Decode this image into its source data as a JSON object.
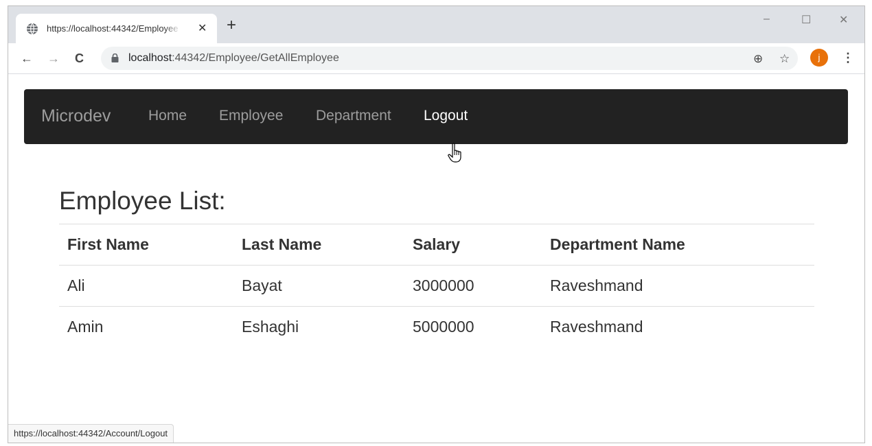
{
  "browser": {
    "tab_title": "https://localhost:44342/Employee",
    "tab_close": "✕",
    "new_tab": "+",
    "window_controls": {
      "minimize": "–",
      "maximize": "☐",
      "close": "✕"
    },
    "nav": {
      "back": "←",
      "forward": "→",
      "reload": "C"
    },
    "url": {
      "host": "localhost",
      "rest": ":44342/Employee/GetAllEmployee"
    },
    "icons": {
      "zoom": "⊕",
      "bookmark": "☆",
      "menu": "⋮"
    },
    "profile_initial": "j",
    "profile_color": "#e8710a",
    "status_url": "https://localhost:44342/Account/Logout"
  },
  "navbar": {
    "brand": "Microdev",
    "links": [
      "Home",
      "Employee",
      "Department",
      "Logout"
    ],
    "active_link": "Logout"
  },
  "page": {
    "title": "Employee List:",
    "columns": [
      "First Name",
      "Last Name",
      "Salary",
      "Department Name"
    ],
    "rows": [
      [
        "Ali",
        "Bayat",
        "3000000",
        "Raveshmand"
      ],
      [
        "Amin",
        "Eshaghi",
        "5000000",
        "Raveshmand"
      ]
    ]
  }
}
